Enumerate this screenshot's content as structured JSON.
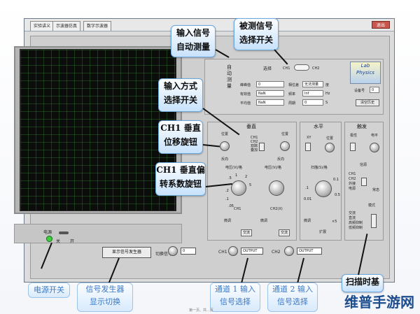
{
  "window": {
    "tabs": [
      "实验讲义",
      "示波器仿真",
      "数字示波器"
    ],
    "exit_label": "退出"
  },
  "auto_measure": {
    "label_lines": [
      "自",
      "动",
      "测",
      "量"
    ],
    "select_label": "选择",
    "ch1": "CH1",
    "ch2": "CH2",
    "rows": [
      {
        "label": "峰峰值",
        "value": "0",
        "label2": "相位差",
        "value2": "无法测量",
        "unit": "度"
      },
      {
        "label": "有效值",
        "value": "NaN",
        "label2": "频率",
        "value2": "Inf",
        "unit": "Hz"
      },
      {
        "label": "平均值",
        "value": "NaN",
        "label2": "周期",
        "value2": "0",
        "unit": "S"
      }
    ],
    "device_label": "设备号",
    "device_value": "0",
    "reset_button": "清空历史",
    "logo_text": [
      "Lab",
      "Physics"
    ]
  },
  "vertical": {
    "title": "垂直",
    "position_label": "位置",
    "mode_options": [
      "CH1",
      "CH2",
      "双踪",
      "叠加"
    ],
    "invert_label": "反向",
    "volts_label": "电压(V)/格",
    "volts_label2": "电压(V)/格",
    "ch1_label": "CH1",
    "ch2_label": "CH2(X)",
    "ticks": [
      ".5",
      "1",
      "2",
      "5",
      ".2",
      ".1",
      ".05"
    ],
    "fine_label": "微调",
    "coupling_label": "交流",
    "fine_label2": "微调",
    "coupling_label2": "交流"
  },
  "horizontal": {
    "title": "水平",
    "xy_label": "XY",
    "position_label": "位置",
    "timebase_label": "扫描(S)/格",
    "ticks": [
      ".1",
      ".01",
      "0.01",
      "0.05",
      "0.1",
      "0.5",
      ".5",
      "10",
      "20"
    ],
    "fine_label": "微调",
    "expand_label": "扩展",
    "expand_value": "×5"
  },
  "trigger": {
    "title": "触发",
    "polarity_label": "极性",
    "level_label": "电平",
    "source_label": "信源",
    "sources": [
      "CH1",
      "CH2",
      "外接",
      "电源"
    ],
    "type_label": "交流",
    "mode_label": "模式",
    "modes": [
      "交流",
      "直流",
      "高频抑制",
      "低频抑制"
    ],
    "scan_label": "常态"
  },
  "bottom": {
    "power_label": "电源",
    "off_label": "关",
    "on_label": "开",
    "siggen_button": "显示信号发生器",
    "switch_signal_label": "切换信号",
    "switch_signal_value": "0",
    "ch1_out_label": "CH1",
    "ch1_out_value": "OUTPUT",
    "ch2_out_label": "CH2",
    "ch2_out_value": "OUTPUT"
  },
  "callouts": {
    "input_auto": [
      "输入信号",
      "自动测量"
    ],
    "signal_select": [
      "被测信号",
      "选择开关"
    ],
    "input_mode": [
      "输入方式",
      "选择开关"
    ],
    "ch1_offset": [
      "CH1  垂直",
      "位移旋钮"
    ],
    "ch1_volts": [
      "CH1  垂直偏",
      "转系数旋钮"
    ],
    "scan_time": "扫描时基"
  },
  "captions": {
    "power": "电源开关",
    "siggen": [
      "信号发生器",
      "显示切换"
    ],
    "ch1_in": [
      "通道 1 输入",
      "信号选择"
    ],
    "ch2_in": [
      "通道 2 输入",
      "信号选择"
    ]
  },
  "page_footer": "第一页、共...页",
  "watermark": "维普手游网"
}
